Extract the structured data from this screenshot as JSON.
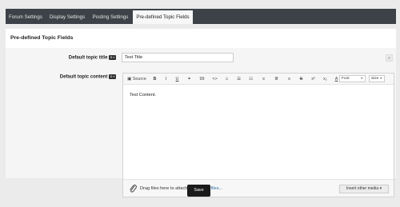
{
  "tabs": [
    {
      "label": "Forum Settings",
      "active": false
    },
    {
      "label": "Display Settings",
      "active": false
    },
    {
      "label": "Posting Settings",
      "active": false
    },
    {
      "label": "Pre-defined Topic Fields",
      "active": true
    }
  ],
  "panel": {
    "title": "Pre-defined Topic Fields",
    "fields": {
      "title": {
        "label": "Default topic title",
        "badge": "Ʃ ≡",
        "value": "Test Title"
      },
      "content": {
        "label": "Default topic content",
        "badge": "Ʃ ≡"
      }
    }
  },
  "editor": {
    "toolbar": {
      "source": "Source",
      "bold": "B",
      "italic": "I",
      "underline": "U",
      "link": "⚭",
      "quote": "99",
      "code": "<>",
      "emoji": "☺",
      "bullet_list": "☰",
      "number_list": "☷",
      "align_left": "≡",
      "align_center": "≣",
      "align_right": "≡",
      "strike": "S",
      "superscript": "x²",
      "subscript": "x₂",
      "font_color": "A",
      "font_dropdown": "Font",
      "size_dropdown": "Size"
    },
    "content": "Test Content.",
    "attach": {
      "text": "Drag files here to attach, or ",
      "link": "choose files...",
      "insert_button": "Insert other media ▾"
    }
  },
  "save_button": "Save"
}
